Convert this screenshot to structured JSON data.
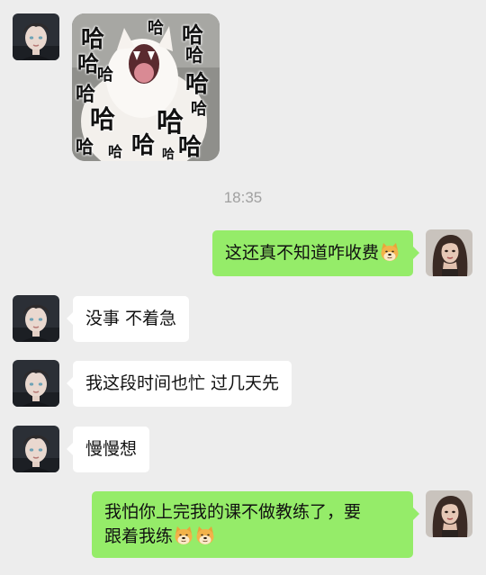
{
  "conversation": {
    "timestamp": "18:35",
    "sticker": {
      "text_marks": [
        "哈",
        "哈",
        "哈",
        "哈",
        "哈",
        "哈",
        "哈",
        "哈",
        "哈",
        "哈",
        "哈",
        "哈",
        "哈",
        "哈",
        "哈",
        "哈"
      ]
    },
    "messages": [
      {
        "sender": "me",
        "text": "这还真不知道咋收费",
        "emoji": [
          "doge-emoji"
        ]
      },
      {
        "sender": "other",
        "text": "没事 不着急"
      },
      {
        "sender": "other",
        "text": "我这段时间也忙 过几天先"
      },
      {
        "sender": "other",
        "text": "慢慢想"
      },
      {
        "sender": "me",
        "line1": "我怕你上完我的课不做教练了，要",
        "line2": "跟着我练",
        "emoji": [
          "doge-emoji",
          "doge-emoji"
        ]
      }
    ]
  },
  "colors": {
    "background": "#ededed",
    "bubble_in": "#ffffff",
    "bubble_out": "#95ec69",
    "timestamp": "#a0a0a0"
  }
}
